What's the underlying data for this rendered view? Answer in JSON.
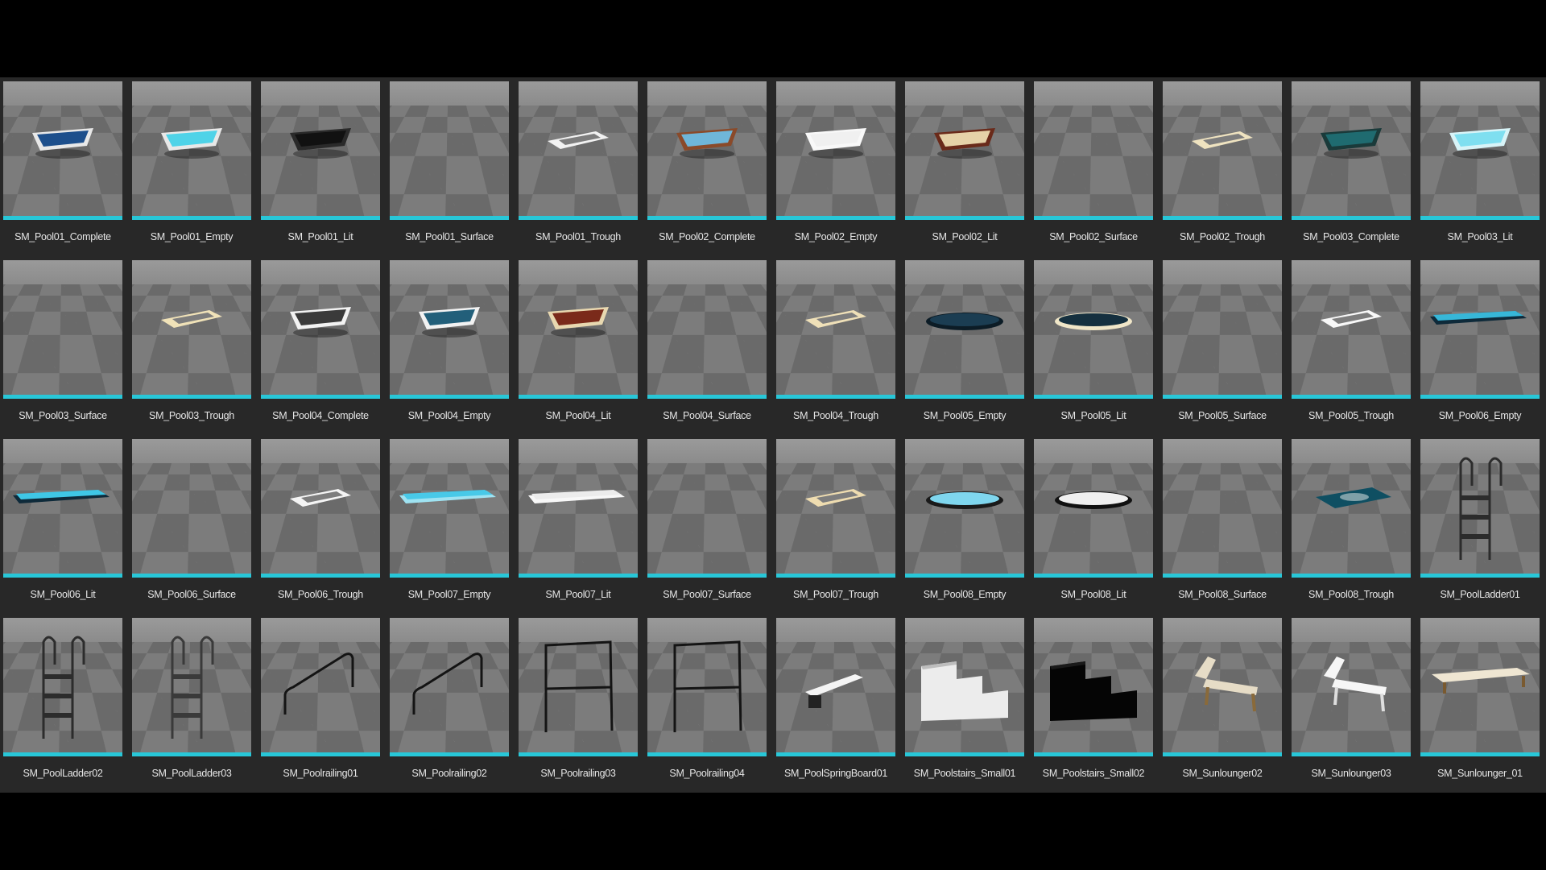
{
  "colors": {
    "background": "#000000",
    "panel": "#282828",
    "accent": "#28c7d8",
    "label": "#e6e6e6"
  },
  "assets": [
    {
      "name": "SM_Pool01_Complete",
      "icon": "pool-icon",
      "fill": "#1d4f8c",
      "rim": "#e8e8e8"
    },
    {
      "name": "SM_Pool01_Empty",
      "icon": "pool-icon",
      "fill": "#4fd3e8",
      "rim": "#e8e8e8"
    },
    {
      "name": "SM_Pool01_Lit",
      "icon": "pool-icon",
      "fill": "#111111",
      "rim": "#2a2a2a"
    },
    {
      "name": "SM_Pool01_Surface",
      "icon": "empty-icon"
    },
    {
      "name": "SM_Pool01_Trough",
      "icon": "trough-icon",
      "rim": "#f2f2f2"
    },
    {
      "name": "SM_Pool02_Complete",
      "icon": "pool-icon",
      "fill": "#6fb6d9",
      "rim": "#8a4a2a"
    },
    {
      "name": "SM_Pool02_Empty",
      "icon": "pool-icon",
      "fill": "#f0f0f0",
      "rim": "#f8f8f8"
    },
    {
      "name": "SM_Pool02_Lit",
      "icon": "pool-icon",
      "fill": "#e6d2a8",
      "rim": "#6a2a1a"
    },
    {
      "name": "SM_Pool02_Surface",
      "icon": "empty-icon"
    },
    {
      "name": "SM_Pool02_Trough",
      "icon": "trough-icon",
      "rim": "#efe3c0"
    },
    {
      "name": "SM_Pool03_Complete",
      "icon": "pool-icon",
      "fill": "#1f6b70",
      "rim": "#1a3a3a"
    },
    {
      "name": "SM_Pool03_Lit",
      "icon": "pool-icon",
      "fill": "#7fdff0",
      "rim": "#d8f4f8"
    },
    {
      "name": "SM_Pool03_Surface",
      "icon": "empty-icon"
    },
    {
      "name": "SM_Pool03_Trough",
      "icon": "trough-icon",
      "rim": "#f0e2b8"
    },
    {
      "name": "SM_Pool04_Complete",
      "icon": "pool-icon",
      "fill": "#3a3a3a",
      "rim": "#f2f2f2"
    },
    {
      "name": "SM_Pool04_Empty",
      "icon": "pool-icon",
      "fill": "#225f7a",
      "rim": "#f2f2f2"
    },
    {
      "name": "SM_Pool04_Lit",
      "icon": "pool-icon",
      "fill": "#7a2a1a",
      "rim": "#e8d8b0"
    },
    {
      "name": "SM_Pool04_Surface",
      "icon": "empty-icon"
    },
    {
      "name": "SM_Pool04_Trough",
      "icon": "trough-icon",
      "rim": "#efe0b8"
    },
    {
      "name": "SM_Pool05_Empty",
      "icon": "round-icon",
      "fill": "#1b3d52",
      "rim": "#0c1c26"
    },
    {
      "name": "SM_Pool05_Lit",
      "icon": "round-icon",
      "fill": "#15303f",
      "rim": "#f0e6c8"
    },
    {
      "name": "SM_Pool05_Surface",
      "icon": "empty-icon"
    },
    {
      "name": "SM_Pool05_Trough",
      "icon": "trough-icon",
      "rim": "#f8f8f8"
    },
    {
      "name": "SM_Pool06_Empty",
      "icon": "long-pool-icon",
      "fill": "#37b7d8",
      "rim": "#0e2a3a"
    },
    {
      "name": "SM_Pool06_Lit",
      "icon": "long-pool-icon",
      "fill": "#3fc7e6",
      "rim": "#0e2a3a"
    },
    {
      "name": "SM_Pool06_Surface",
      "icon": "empty-icon"
    },
    {
      "name": "SM_Pool06_Trough",
      "icon": "trough-icon",
      "rim": "#f4f4f4"
    },
    {
      "name": "SM_Pool07_Empty",
      "icon": "long-pool-icon",
      "fill": "#48c9e8",
      "rim": "#9fe3f2"
    },
    {
      "name": "SM_Pool07_Lit",
      "icon": "long-pool-icon",
      "fill": "#ececec",
      "rim": "#f8f8f8"
    },
    {
      "name": "SM_Pool07_Surface",
      "icon": "empty-icon"
    },
    {
      "name": "SM_Pool07_Trough",
      "icon": "trough-icon",
      "rim": "#eedcb0"
    },
    {
      "name": "SM_Pool08_Empty",
      "icon": "round-icon",
      "fill": "#7fd6ee",
      "rim": "#1a1a1a"
    },
    {
      "name": "SM_Pool08_Lit",
      "icon": "round-icon",
      "fill": "#f0f0f0",
      "rim": "#111111"
    },
    {
      "name": "SM_Pool08_Surface",
      "icon": "empty-icon"
    },
    {
      "name": "SM_Pool08_Trough",
      "icon": "mat-icon",
      "fill": "#0f4f62",
      "rim": "#7fa0a8"
    },
    {
      "name": "SM_PoolLadder01",
      "icon": "ladder-icon",
      "rim": "#2c2c2c"
    },
    {
      "name": "SM_PoolLadder02",
      "icon": "ladder-icon",
      "rim": "#2c2c2c"
    },
    {
      "name": "SM_PoolLadder03",
      "icon": "ladder-icon",
      "rim": "#3a3a3a"
    },
    {
      "name": "SM_Poolrailing01",
      "icon": "railing-icon",
      "rim": "#141414"
    },
    {
      "name": "SM_Poolrailing02",
      "icon": "railing-icon",
      "rim": "#141414"
    },
    {
      "name": "SM_Poolrailing03",
      "icon": "frame-icon",
      "rim": "#141414"
    },
    {
      "name": "SM_Poolrailing04",
      "icon": "frame-icon",
      "rim": "#141414"
    },
    {
      "name": "SM_PoolSpringBoard01",
      "icon": "springboard-icon",
      "fill": "#f4f4f4",
      "rim": "#222222"
    },
    {
      "name": "SM_Poolstairs_Small01",
      "icon": "stairs-icon",
      "fill": "#ececec",
      "rim": "#bdbdbd"
    },
    {
      "name": "SM_Poolstairs_Small02",
      "icon": "stairs-icon",
      "fill": "#050505",
      "rim": "#1a1a1a"
    },
    {
      "name": "SM_Sunlounger02",
      "icon": "lounger-icon",
      "fill": "#e6dcc6",
      "rim": "#8a6a3a"
    },
    {
      "name": "SM_Sunlounger03",
      "icon": "lounger-icon",
      "fill": "#f6f6f6",
      "rim": "#dedede"
    },
    {
      "name": "SM_Sunlounger_01",
      "icon": "bed-icon",
      "fill": "#efe6d2",
      "rim": "#7a5a30"
    }
  ]
}
